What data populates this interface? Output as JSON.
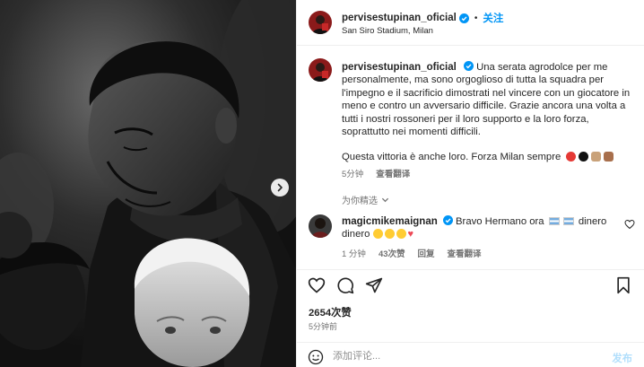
{
  "header": {
    "username": "pervisestupinan_oficial",
    "follow_label": "关注",
    "location": "San Siro Stadium, Milan",
    "separator": "•"
  },
  "caption": {
    "username": "pervisestupinan_oficial",
    "text": "Una serata agrodolce per me personalmente, ma sono orgoglioso di tutta la squadra per l'impegno e il sacrificio dimostrati nel vincere con un giocatore in meno e contro un avversario difficile. Grazie ancora una volta a tutti i nostri rossoneri per il loro supporto e la loro forza, soprattutto nei momenti difficili.",
    "text2": "Questa vittoria è anche loro. Forza Milan sempre",
    "time": "5分钟",
    "translate_label": "查看翻译"
  },
  "picks_label": "为你精选",
  "comment": {
    "username": "magicmikemaignan",
    "text_a": "Bravo Hermano ora",
    "text_b": "dinero dinero",
    "time": "1 分钟",
    "likes": "43次赞",
    "reply_label": "回复",
    "translate_label": "查看翻译"
  },
  "post": {
    "likes": "2654次赞",
    "time_ago": "5分钟前"
  },
  "comment_bar": {
    "placeholder": "添加评论...",
    "post_label": "发布"
  },
  "icons": {
    "like": "heart-icon",
    "comment": "comment-bubble-icon",
    "share": "paper-plane-icon",
    "save": "bookmark-icon",
    "emoji": "smiley-icon",
    "next": "chevron-right-icon",
    "verified": "verified-badge-icon"
  },
  "colors": {
    "accent": "#0095f6",
    "muted": "#737373",
    "verified": "#0095f6",
    "post_disabled": "#b2dffc"
  }
}
